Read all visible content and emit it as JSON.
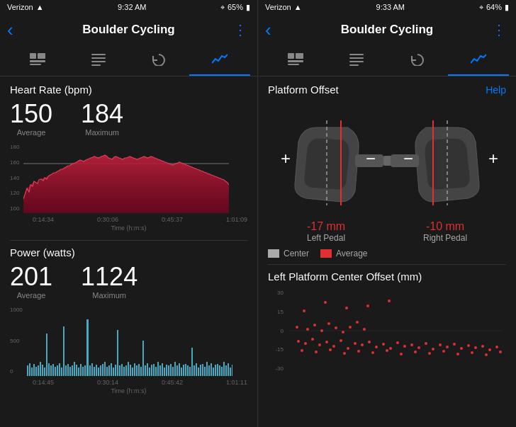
{
  "left_panel": {
    "status_bar": {
      "carrier": "Verizon",
      "time": "9:32 AM",
      "battery": "65%"
    },
    "header": {
      "title": "Boulder Cycling",
      "back_label": "‹"
    },
    "tabs": [
      {
        "id": "overview",
        "icon": "▤",
        "active": false
      },
      {
        "id": "details",
        "icon": "≡",
        "active": false
      },
      {
        "id": "history",
        "icon": "↺",
        "active": false
      },
      {
        "id": "charts",
        "icon": "📈",
        "active": true
      }
    ],
    "heart_rate": {
      "title": "Heart Rate (bpm)",
      "average_label": "Average",
      "maximum_label": "Maximum",
      "average_value": "150",
      "maximum_value": "184",
      "time_labels": [
        "0:14:34",
        "0:30:06",
        "0:45:37",
        "1:01:09"
      ],
      "axis_label": "Time (h:m:s)",
      "y_values": [
        "180",
        "160",
        "140",
        "120",
        "100"
      ]
    },
    "power": {
      "title": "Power (watts)",
      "average_label": "Average",
      "maximum_label": "Maximum",
      "average_value": "201",
      "maximum_value": "1124",
      "time_labels": [
        "0:14:45",
        "0:30:14",
        "0:45:42",
        "1:01:11"
      ],
      "axis_label": "Time (h:m:s)",
      "y_values": [
        "1000",
        "500",
        "0"
      ]
    }
  },
  "right_panel": {
    "status_bar": {
      "carrier": "Verizon",
      "time": "9:33 AM",
      "battery": "64%"
    },
    "header": {
      "title": "Boulder Cycling",
      "back_label": "‹"
    },
    "platform_offset": {
      "section_title": "Platform Offset",
      "help_label": "Help",
      "left_offset": "-17 mm",
      "left_label": "Left Pedal",
      "right_offset": "-10 mm",
      "right_label": "Right Pedal",
      "legend_center": "Center",
      "legend_average": "Average"
    },
    "scatter": {
      "title": "Left Platform Center Offset (mm)",
      "y_values": [
        "30",
        "15",
        "0",
        "-15",
        "-30"
      ]
    }
  },
  "colors": {
    "accent": "#007AFF",
    "heart_rate_fill": "#c0203a",
    "power_fill": "#4fc3e0",
    "background": "#1a1a1a",
    "text_primary": "#ffffff",
    "text_secondary": "#888888",
    "red_offset": "#e03030"
  },
  "icons": {
    "back": "‹",
    "more": "⋮",
    "tab_overview": "🖼",
    "tab_list": "📋",
    "tab_link": "🔗",
    "tab_chart": "📊"
  }
}
